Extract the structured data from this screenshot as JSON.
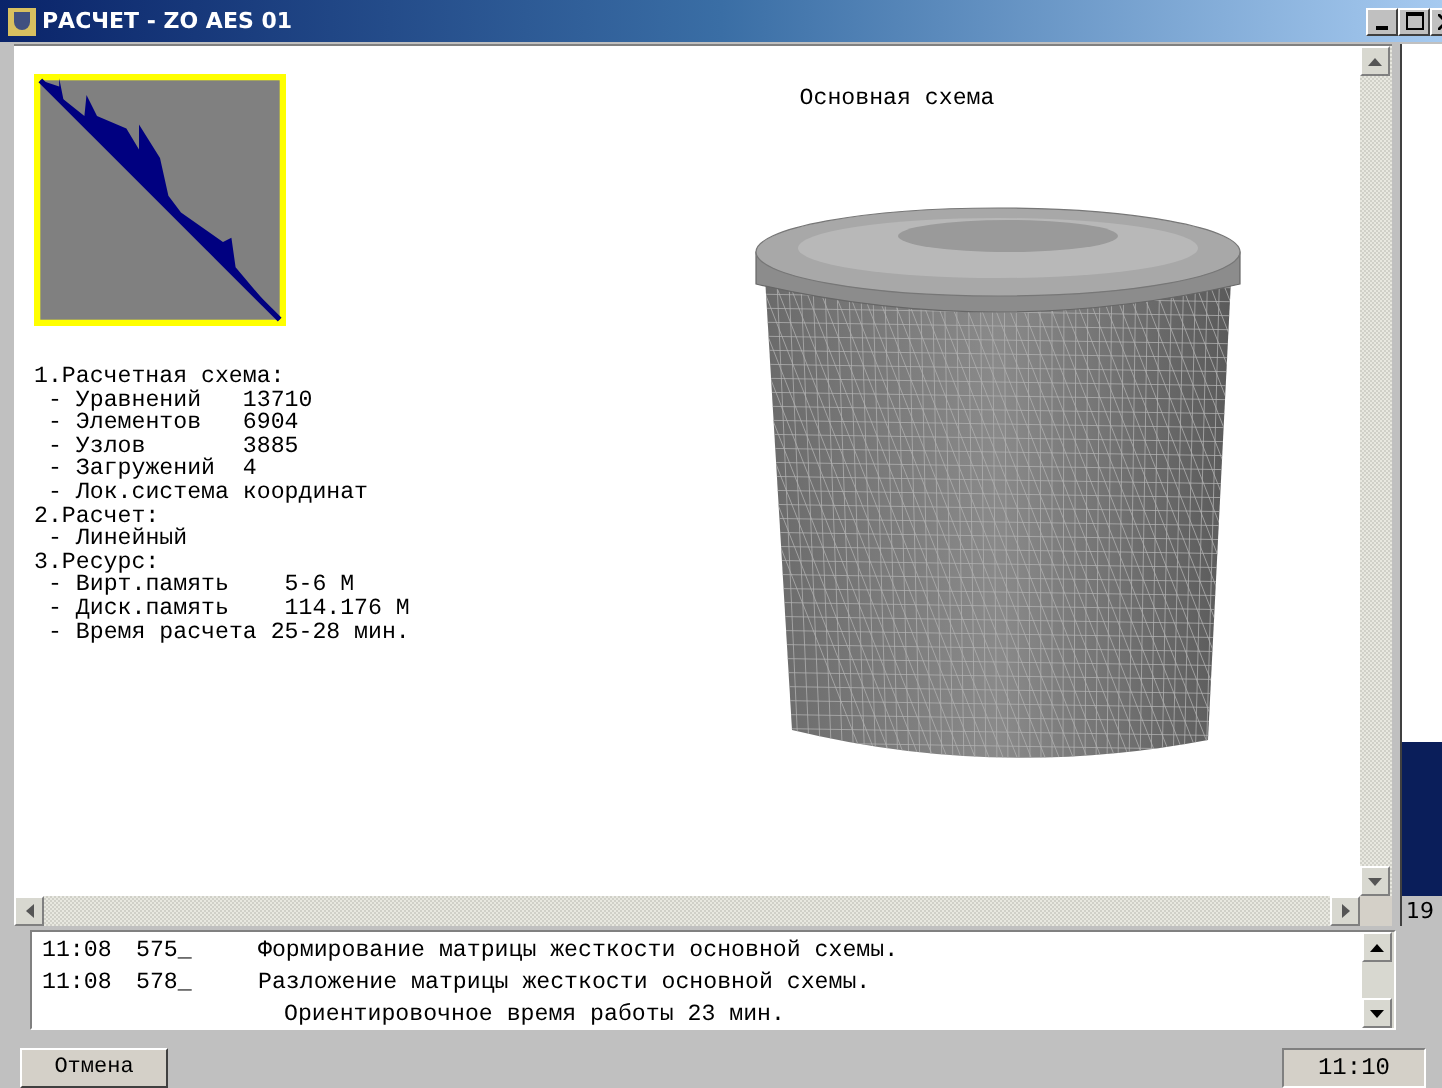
{
  "window": {
    "title": "РАСЧЕТ - ZO AES 01"
  },
  "canvas": {
    "caption": "Основная схема",
    "sections": [
      {
        "heading": "1.Расчетная схема:",
        "items": [
          "- Уравнений   13710",
          "- Элементов   6904",
          "- Узлов       3885",
          "- Загружений  4",
          "- Лок.система координат"
        ]
      },
      {
        "heading": "2.Расчет:",
        "items": [
          "- Линейный"
        ]
      },
      {
        "heading": "3.Ресурс:",
        "items": [
          "- Вирт.память    5-6 М",
          "- Диск.память    114.176 М",
          "- Время расчета 25-28 мин."
        ]
      }
    ]
  },
  "side_panel": {
    "level": 0.18,
    "reading": "19"
  },
  "log": [
    {
      "time": "11:08",
      "code": "575_",
      "message": "Формирование матрицы жесткости основной схемы."
    },
    {
      "time": "11:08",
      "code": "578_",
      "message": "Разложение матрицы жесткости основной схемы."
    },
    {
      "message": "Ориентировочное время работы 23 мин."
    }
  ],
  "status_bar": {
    "cancel_button": "Отмена",
    "clock": "11:10"
  }
}
